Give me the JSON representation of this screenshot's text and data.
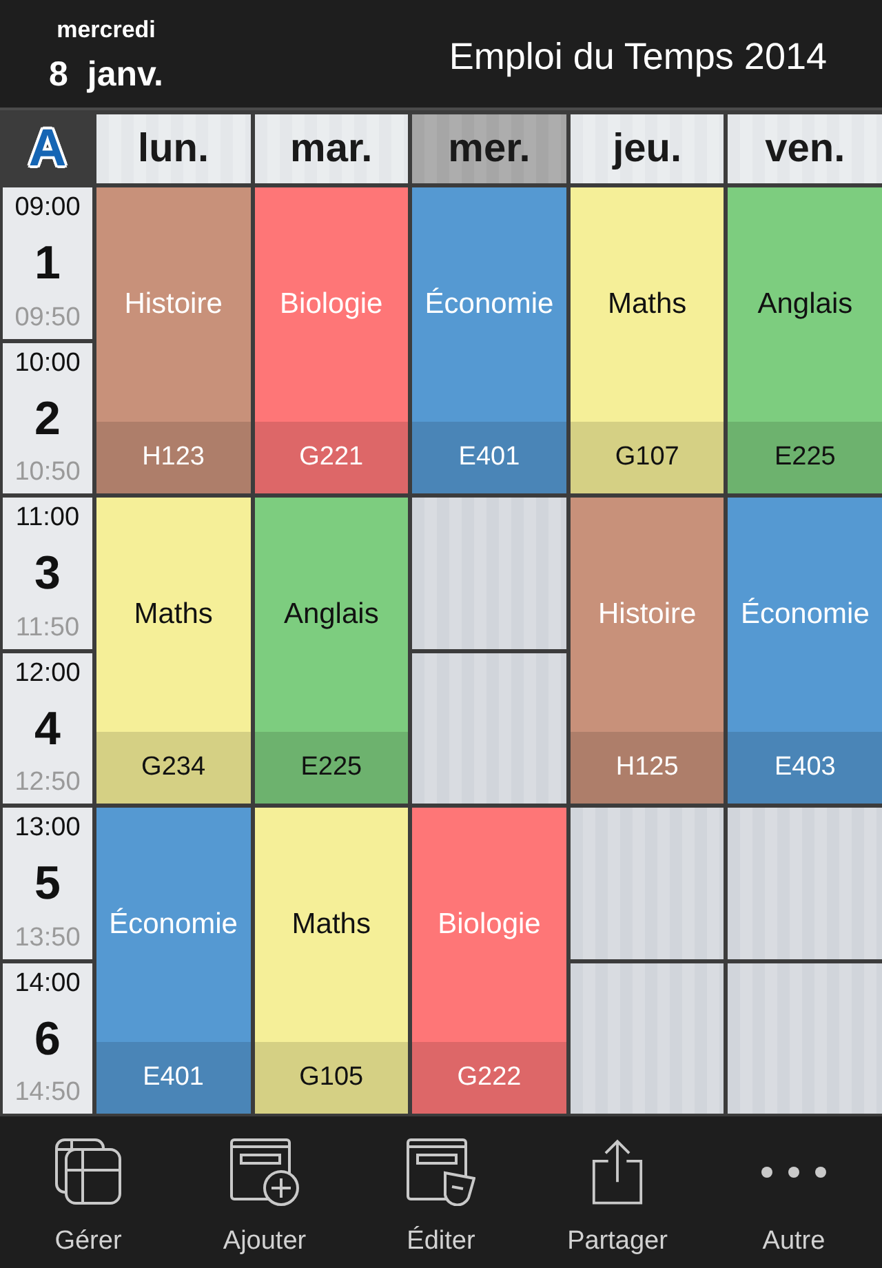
{
  "header": {
    "weekday": "mercredi",
    "day": "8",
    "month": "janv.",
    "title": "Emploi du Temps 2014"
  },
  "logo": "A",
  "days": [
    {
      "label": "lun.",
      "today": false
    },
    {
      "label": "mar.",
      "today": false
    },
    {
      "label": "mer.",
      "today": true
    },
    {
      "label": "jeu.",
      "today": false
    },
    {
      "label": "ven.",
      "today": false
    }
  ],
  "schedule": [
    {
      "periods": [
        {
          "start": "09:00",
          "number": "1",
          "end": "09:50"
        },
        {
          "start": "10:00",
          "number": "2",
          "end": "10:50"
        }
      ],
      "cells": [
        {
          "kind": "lesson",
          "subject": "Histoire",
          "room": "H123",
          "color": "#c8917a"
        },
        {
          "kind": "lesson",
          "subject": "Biologie",
          "room": "G221",
          "color": "#fe7677"
        },
        {
          "kind": "lesson",
          "subject": "Économie",
          "room": "E401",
          "color": "#5599d2"
        },
        {
          "kind": "lesson",
          "subject": "Maths",
          "room": "G107",
          "color": "#f5ef98"
        },
        {
          "kind": "lesson",
          "subject": "Anglais",
          "room": "E225",
          "color": "#7dcd7f"
        }
      ]
    },
    {
      "periods": [
        {
          "start": "11:00",
          "number": "3",
          "end": "11:50"
        },
        {
          "start": "12:00",
          "number": "4",
          "end": "12:50"
        }
      ],
      "cells": [
        {
          "kind": "lesson",
          "subject": "Maths",
          "room": "G234",
          "color": "#f5ef98"
        },
        {
          "kind": "lesson",
          "subject": "Anglais",
          "room": "E225",
          "color": "#7dcd7f"
        },
        {
          "kind": "empty"
        },
        {
          "kind": "lesson",
          "subject": "Histoire",
          "room": "H125",
          "color": "#c8917a"
        },
        {
          "kind": "lesson",
          "subject": "Économie",
          "room": "E403",
          "color": "#5599d2"
        }
      ]
    },
    {
      "periods": [
        {
          "start": "13:00",
          "number": "5",
          "end": "13:50"
        },
        {
          "start": "14:00",
          "number": "6",
          "end": "14:50"
        }
      ],
      "cells": [
        {
          "kind": "lesson",
          "subject": "Économie",
          "room": "E401",
          "color": "#5599d2"
        },
        {
          "kind": "lesson",
          "subject": "Maths",
          "room": "G105",
          "color": "#f5ef98"
        },
        {
          "kind": "lesson",
          "subject": "Biologie",
          "room": "G222",
          "color": "#fe7677"
        },
        {
          "kind": "empty"
        },
        {
          "kind": "empty"
        }
      ]
    }
  ],
  "toolbar": [
    {
      "kind": "manage",
      "label": "Gérer"
    },
    {
      "kind": "add",
      "label": "Ajouter"
    },
    {
      "kind": "edit",
      "label": "Éditer"
    },
    {
      "kind": "share",
      "label": "Partager"
    },
    {
      "kind": "more",
      "label": "Autre"
    }
  ]
}
